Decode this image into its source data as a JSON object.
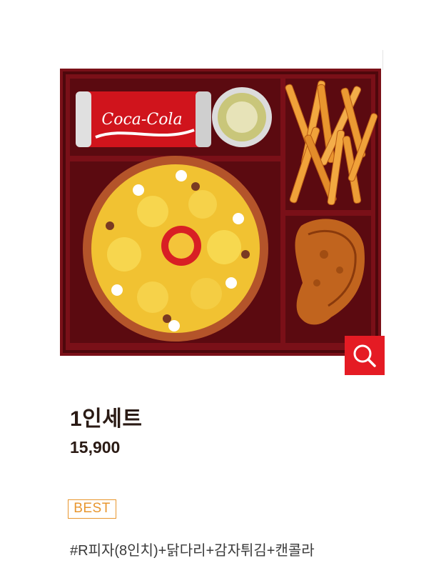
{
  "product": {
    "name": "1인세트",
    "price": "15,900",
    "badge": "BEST",
    "description": "#R피자(8인치)+닭다리+감자튀김+캔콜라",
    "image_label": "Coca-Cola"
  },
  "zoom_button": {
    "icon": "magnifier-icon"
  },
  "colors": {
    "zoom_button_bg": "#e51b24",
    "badge_color": "#e8962e",
    "text_dark": "#2a1a14",
    "tray": "#6e0d13"
  }
}
